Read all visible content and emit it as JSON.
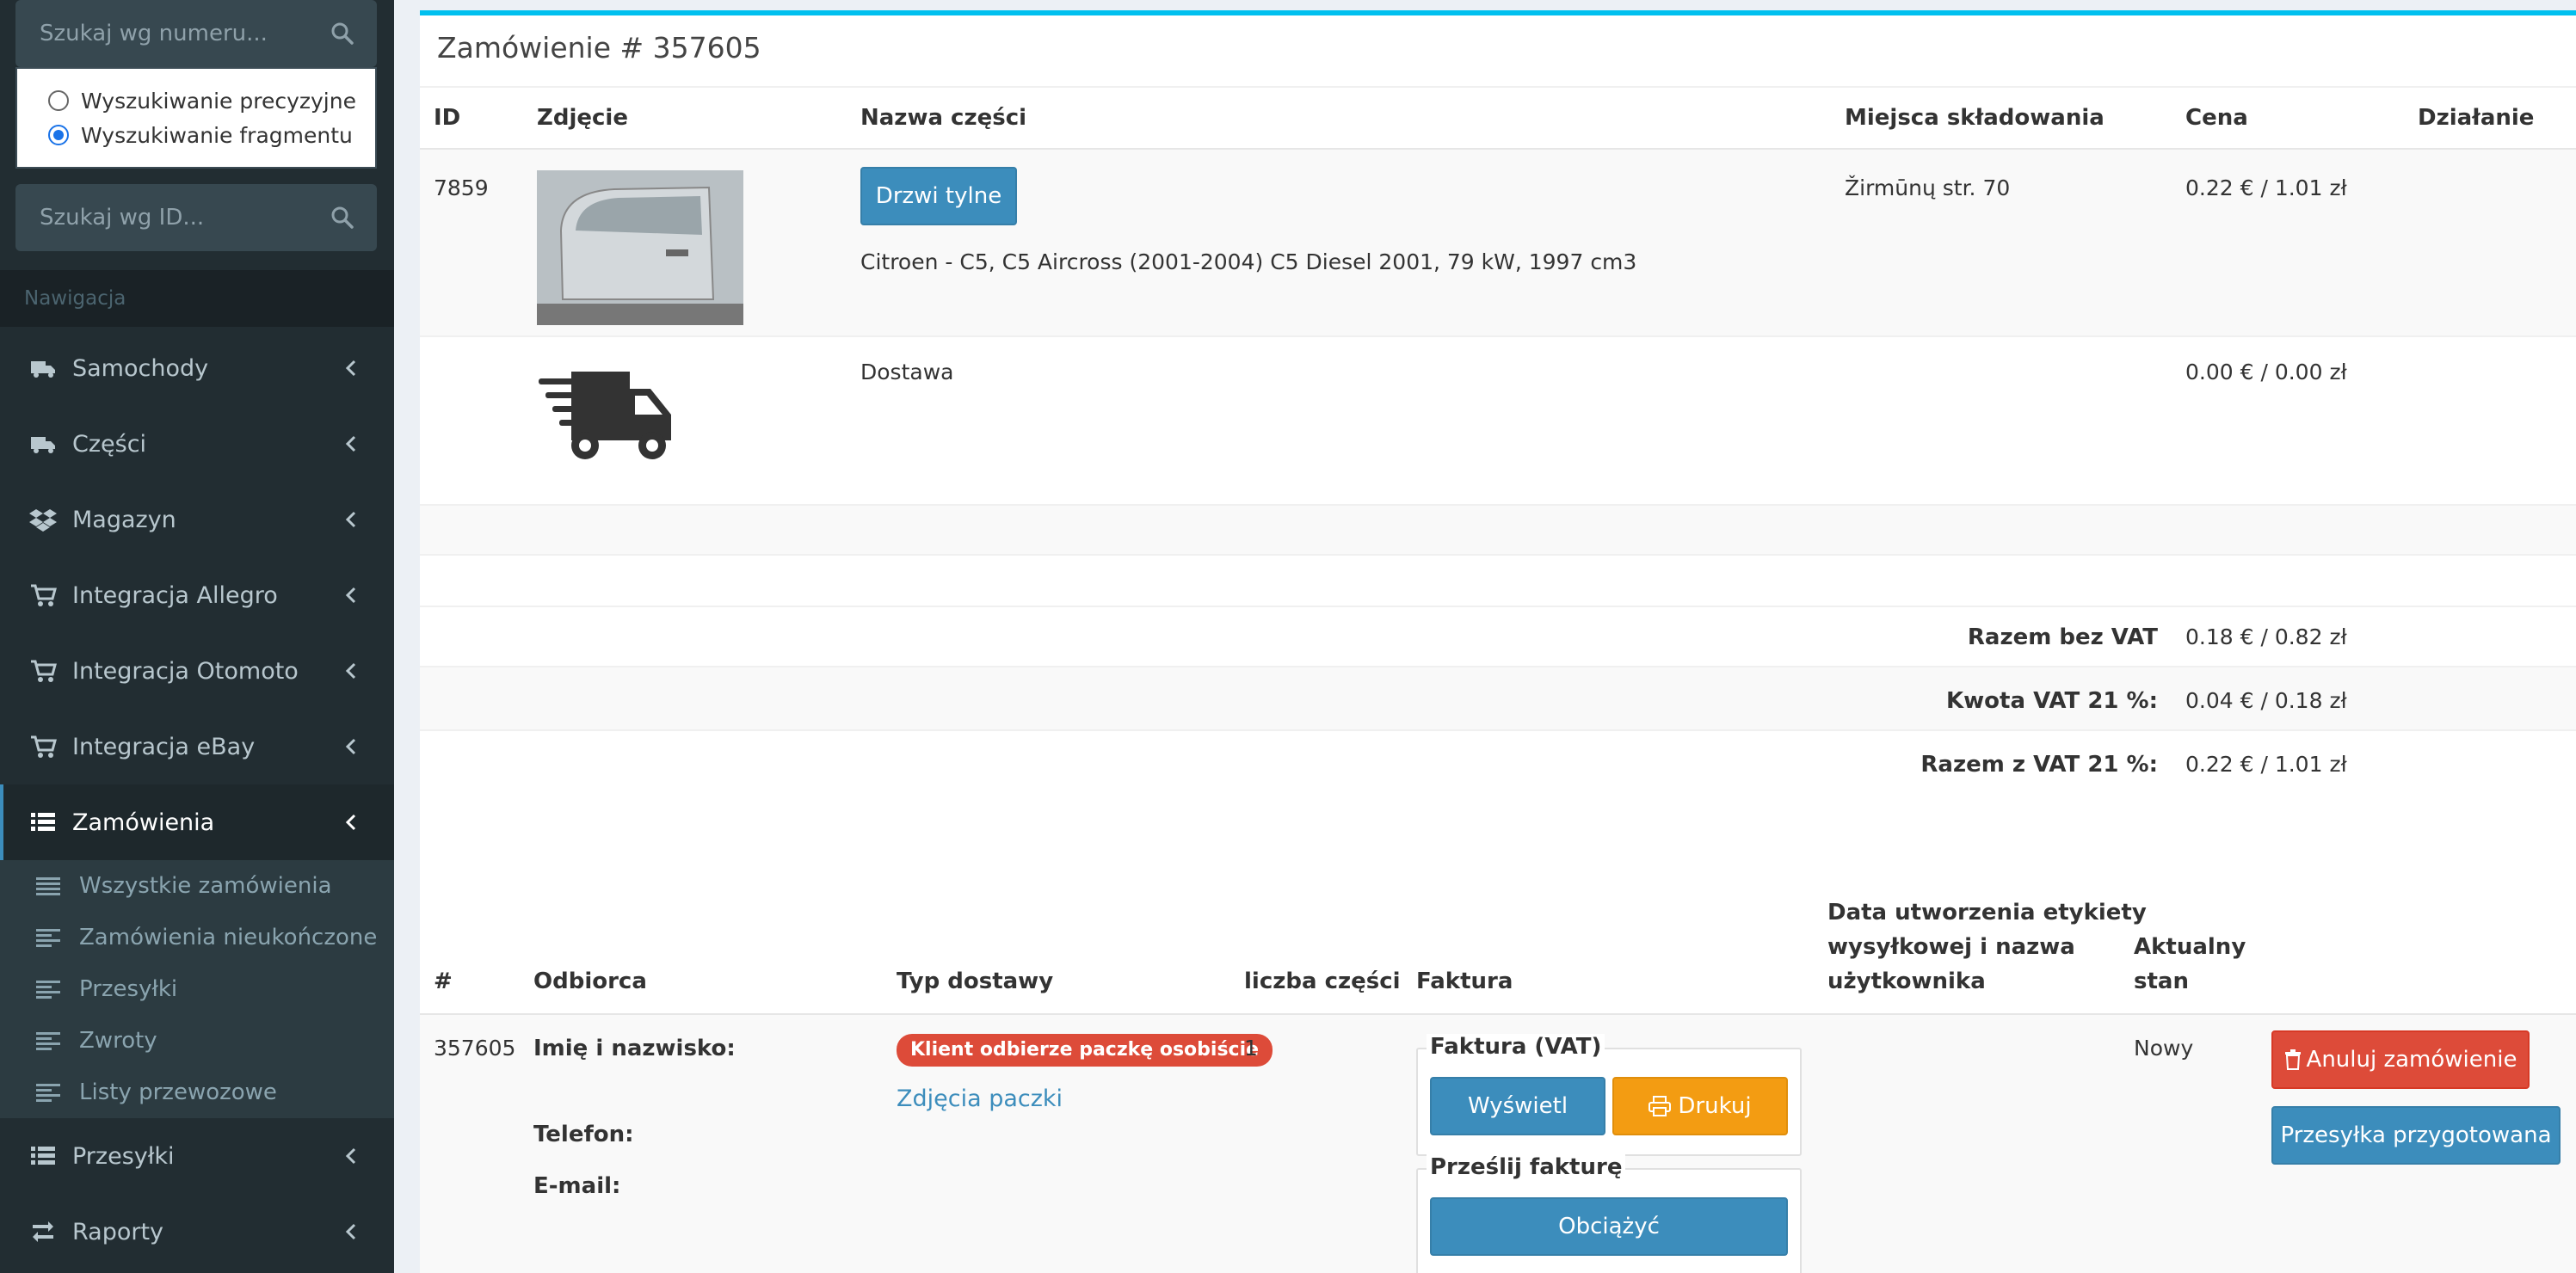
{
  "sidebar": {
    "search_number": {
      "placeholder": "Szukaj wg numeru..."
    },
    "search_id": {
      "placeholder": "Szukaj wg ID..."
    },
    "radios": [
      {
        "label": "Wyszukiwanie precyzyjne",
        "checked": false
      },
      {
        "label": "Wyszukiwanie fragmentu",
        "checked": true
      }
    ],
    "nav_header": "Nawigacja",
    "nav_items": [
      {
        "label": "Samochody",
        "icon": "truck-icon"
      },
      {
        "label": "Części",
        "icon": "truck-icon"
      },
      {
        "label": "Magazyn",
        "icon": "dropbox-icon"
      },
      {
        "label": "Integracja Allegro",
        "icon": "cart-icon"
      },
      {
        "label": "Integracja Otomoto",
        "icon": "cart-icon"
      },
      {
        "label": "Integracja eBay",
        "icon": "cart-icon"
      },
      {
        "label": "Zamówienia",
        "icon": "list-icon",
        "active": true
      },
      {
        "label": "Przesyłki",
        "icon": "list-icon"
      },
      {
        "label": "Raporty",
        "icon": "retweet-icon"
      }
    ],
    "sub_items": [
      {
        "label": "Wszystkie zamówienia"
      },
      {
        "label": "Zamówienia nieukończone"
      },
      {
        "label": "Przesyłki"
      },
      {
        "label": "Zwroty"
      },
      {
        "label": "Listy przewozowe"
      }
    ]
  },
  "order": {
    "title": "Zamówienie # 357605",
    "items_table": {
      "headers": {
        "id": "ID",
        "photo": "Zdjęcie",
        "name": "Nazwa części",
        "location": "Miejsca składowania",
        "price": "Cena",
        "action": "Działanie"
      },
      "rows": [
        {
          "id": "7859",
          "name_button": "Drzwi tylne",
          "description": "Citroen - C5, C5 Aircross (2001-2004) C5 Diesel 2001, 79 kW, 1997 cm3",
          "location": "Žirmūnų str. 70",
          "price": "0.22 € / 1.01 zł"
        },
        {
          "name": "Dostawa",
          "price": "0.00 € / 0.00 zł",
          "icon": "delivery-truck-icon"
        }
      ]
    },
    "totals": [
      {
        "label": "Razem bez VAT",
        "value": "0.18 € / 0.82 zł"
      },
      {
        "label": "Kwota VAT 21 %:",
        "value": "0.04 € / 0.18 zł"
      },
      {
        "label": "Razem z VAT 21 %:",
        "value": "0.22 € / 1.01 zł"
      }
    ],
    "shipping_table": {
      "headers": {
        "num": "#",
        "recipient": "Odbiorca",
        "delivery": "Typ dostawy",
        "count": "liczba części",
        "invoice": "Faktura",
        "label_date_1": "Data utworzenia etykiety",
        "label_date_2": "wysyłkowej i nazwa",
        "label_date_3": "użytkownika",
        "status_1": "Aktualny",
        "status_2": "stan"
      },
      "row": {
        "num": "357605",
        "name_label": "Imię i nazwisko:",
        "phone_label": "Telefon:",
        "email_label": "E-mail:",
        "delivery_badge": "Klient odbierze paczkę osobiście",
        "photos_link": "Zdjęcia paczki",
        "count": "1",
        "invoice_legend": "Faktura (VAT)",
        "view_button": "Wyświetl",
        "print_button": "Drukuj",
        "send_legend": "Prześlij fakturę",
        "charge_button": "Obciążyć",
        "status": "Nowy",
        "cancel_button": "Anuluj zamówienie",
        "prepared_button": "Przesyłka przygotowana"
      }
    }
  },
  "colors": {
    "sidebar_bg": "#222d32",
    "accent": "#3c8dbc",
    "top_border": "#00c0ef",
    "danger": "#dd4b39",
    "warning": "#f39c12"
  }
}
